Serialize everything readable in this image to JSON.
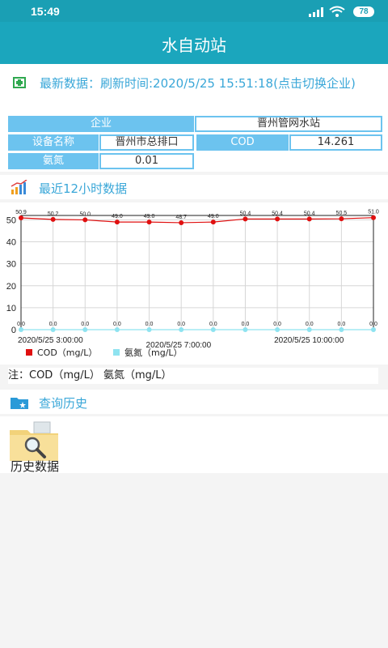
{
  "status_bar": {
    "time": "15:49",
    "battery": "78"
  },
  "header": {
    "title": "水自动站"
  },
  "latest": {
    "text": "最新数据：刷新时间:2020/5/25 15:51:18(点击切换企业)"
  },
  "info": {
    "company_label": "企业",
    "company_value": "晋州管网水站",
    "device_label": "设备名称",
    "device_value": "晋州市总排口",
    "cod_label": "COD",
    "cod_value": "14.261",
    "nh_label": "氨氮",
    "nh_value": "0.01"
  },
  "recent": {
    "title": "最近12小时数据"
  },
  "chart_data": {
    "type": "line",
    "ylim": [
      0,
      52
    ],
    "yticks": [
      "0",
      "10",
      "20",
      "30",
      "40",
      "50"
    ],
    "x_tick_labels": [
      "2020/5/25 3:00:00",
      "2020/5/25 7:00:00",
      "2020/5/25 10:00:00"
    ],
    "series": [
      {
        "name": "COD（mg/L）",
        "color": "#e01010",
        "values": [
          50.9,
          50.2,
          50.0,
          49.0,
          49.0,
          48.7,
          49.0,
          50.4,
          50.4,
          50.4,
          50.5,
          51.0
        ],
        "labels": [
          "50.9",
          "50.2",
          "50.0",
          "49.0",
          "49.0",
          "48.7",
          "49.0",
          "50.4",
          "50.4",
          "50.4",
          "50.5",
          "51.0"
        ]
      },
      {
        "name": "氨氮（mg/L）",
        "color": "#8fe3f0",
        "values": [
          0,
          0,
          0,
          0,
          0,
          0,
          0,
          0,
          0,
          0,
          0,
          0
        ],
        "labels": [
          "0.0",
          "0.0",
          "0.0",
          "0.0",
          "0.0",
          "0.0",
          "0.0",
          "0.0",
          "0.0",
          "0.0",
          "0.0",
          "0.0"
        ]
      }
    ],
    "legend": "bottom-left",
    "grid": true
  },
  "note": {
    "text": "注：COD（mg/L） 氨氮（mg/L）"
  },
  "history": {
    "title": "查询历史",
    "item_label": "历史数据"
  }
}
